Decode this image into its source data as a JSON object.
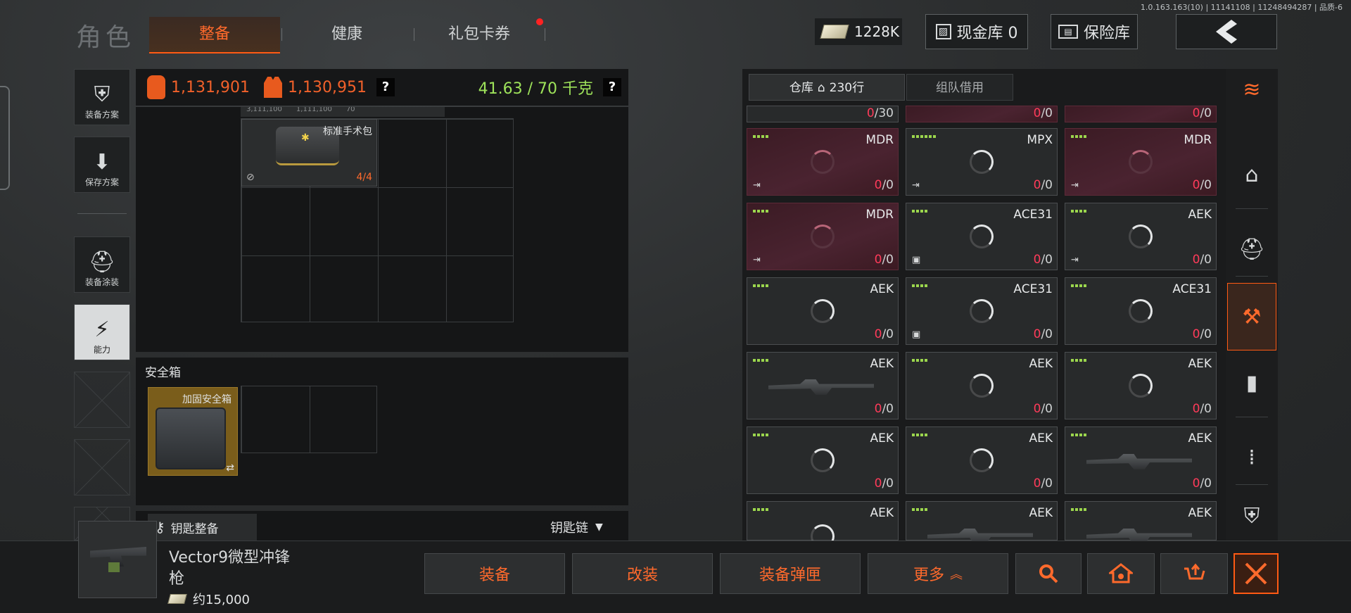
{
  "version": "1.0.163.163(10) | 11141108 | 11248494287 | 品质-6",
  "header": {
    "title": "角色",
    "tabs": [
      {
        "label": "整备",
        "active": true
      },
      {
        "label": "健康",
        "active": false
      },
      {
        "label": "礼包卡券",
        "active": false,
        "badge": true
      }
    ],
    "money": "1228K",
    "cash_vault": "现金库 0",
    "insurance": "保险库",
    "back_icon": "chevron-left-icon"
  },
  "left_sidebar": [
    {
      "label": "装备方案",
      "icon": "vest-icon"
    },
    {
      "label": "保存方案",
      "icon": "download-icon"
    },
    {
      "label": "装备涂装",
      "icon": "helmet-icon"
    },
    {
      "label": "能力",
      "icon": "lightning-icon",
      "active": true
    }
  ],
  "stats": {
    "backpack_value": "1,131,901",
    "vest_value": "1,130,951",
    "weight": "41.63 / 70 千克",
    "help": "?"
  },
  "container": {
    "partial_top_labels": [
      "3,111,100",
      "1,111,100",
      "70"
    ],
    "item_name": "标准手术包",
    "item_count": "4/4"
  },
  "safe_box": {
    "title": "安全箱",
    "item_name": "加固安全箱",
    "swap_icon": "⇄"
  },
  "keys": {
    "button": "钥匙整备",
    "dropdown": "钥匙链"
  },
  "warehouse": {
    "tab_main": "仓库",
    "tab_main_count": "230行",
    "tab_team": "组队借用",
    "top_partial": [
      {
        "zero": "0",
        "rest": "/30"
      },
      {
        "zero": "0",
        "rest": "/0"
      },
      {
        "zero": "0",
        "rest": "/0"
      }
    ],
    "cells": [
      {
        "name": "MDR",
        "red": true,
        "dots": 4,
        "zero": "0",
        "rest": "/0",
        "tag": "exit"
      },
      {
        "name": "MPX",
        "red": false,
        "dots": 6,
        "zero": "0",
        "rest": "/0",
        "tag": "exit"
      },
      {
        "name": "MDR",
        "red": true,
        "dots": 4,
        "zero": "0",
        "rest": "/0",
        "tag": "exit"
      },
      {
        "name": "MDR",
        "red": true,
        "dots": 4,
        "zero": "0",
        "rest": "/0",
        "tag": "exit"
      },
      {
        "name": "ACE31",
        "red": false,
        "dots": 4,
        "zero": "0",
        "rest": "/0",
        "tag": "box"
      },
      {
        "name": "AEK",
        "red": false,
        "dots": 4,
        "zero": "0",
        "rest": "/0",
        "tag": "exit"
      },
      {
        "name": "AEK",
        "red": false,
        "dots": 4,
        "zero": "0",
        "rest": "/0",
        "tag": ""
      },
      {
        "name": "ACE31",
        "red": false,
        "dots": 4,
        "zero": "0",
        "rest": "/0",
        "tag": "box"
      },
      {
        "name": "ACE31",
        "red": false,
        "dots": 4,
        "zero": "0",
        "rest": "/0",
        "tag": ""
      },
      {
        "name": "AEK",
        "red": false,
        "dots": 4,
        "zero": "0",
        "rest": "/0",
        "tag": "",
        "gun": true
      },
      {
        "name": "AEK",
        "red": false,
        "dots": 4,
        "zero": "0",
        "rest": "/0",
        "tag": ""
      },
      {
        "name": "AEK",
        "red": false,
        "dots": 4,
        "zero": "0",
        "rest": "/0",
        "tag": ""
      },
      {
        "name": "AEK",
        "red": false,
        "dots": 4,
        "zero": "0",
        "rest": "/0",
        "tag": ""
      },
      {
        "name": "AEK",
        "red": false,
        "dots": 4,
        "zero": "0",
        "rest": "/0",
        "tag": ""
      },
      {
        "name": "AEK",
        "red": false,
        "dots": 4,
        "zero": "0",
        "rest": "/0",
        "tag": "",
        "gun": true
      },
      {
        "name": "AEK",
        "red": false,
        "dots": 4,
        "zero": "",
        "rest": "",
        "tag": ""
      },
      {
        "name": "AEK",
        "red": false,
        "dots": 4,
        "zero": "",
        "rest": "",
        "tag": "",
        "gun": true
      },
      {
        "name": "AEK",
        "red": false,
        "dots": 4,
        "zero": "",
        "rest": "",
        "tag": "",
        "gun": true
      }
    ]
  },
  "right_sidebar": [
    {
      "icon": "layers-refresh-icon",
      "active": false
    },
    {
      "icon": "home-icon",
      "active": false
    },
    {
      "icon": "helmet-icon",
      "active": false
    },
    {
      "icon": "weapon-hand-icon",
      "active": true
    },
    {
      "icon": "magazine-icon",
      "active": false
    },
    {
      "icon": "bullet-icon",
      "active": false
    },
    {
      "icon": "armor-icon",
      "active": false
    }
  ],
  "selected_item": {
    "name_line1": "Vector9微型冲锋",
    "name_line2": "枪",
    "price": "约15,000"
  },
  "actions": {
    "equip": "装备",
    "modify": "改装",
    "equip_mag": "装备弹匣",
    "more": "更多"
  },
  "colors": {
    "accent": "#ff5a14",
    "weight_green": "#9ee35a",
    "zero_red": "#ff3b5a"
  }
}
